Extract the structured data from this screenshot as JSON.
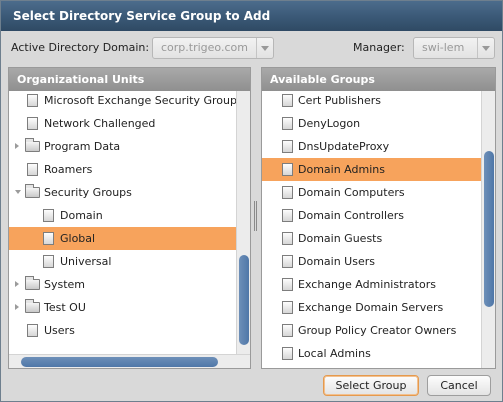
{
  "dialog": {
    "title": "Select Directory Service Group to Add"
  },
  "filters": {
    "domain_label": "Active Directory Domain:",
    "domain_value": "corp.trigeo.com",
    "manager_label": "Manager:",
    "manager_value": "swi-lem"
  },
  "left_panel": {
    "header": "Organizational Units",
    "items": [
      {
        "label": "Microsoft Exchange Security Groups",
        "icon": "document-icon"
      },
      {
        "label": "Network Challenged",
        "icon": "document-icon"
      },
      {
        "label": "Program Data",
        "icon": "folder-icon",
        "expander": "collapsed"
      },
      {
        "label": "Roamers",
        "icon": "document-icon"
      },
      {
        "label": "Security Groups",
        "icon": "folder-open-icon",
        "expander": "expanded"
      },
      {
        "label": "Domain",
        "icon": "document-icon"
      },
      {
        "label": "Global",
        "icon": "document-icon",
        "selected": true
      },
      {
        "label": "Universal",
        "icon": "document-icon"
      },
      {
        "label": "System",
        "icon": "folder-icon",
        "expander": "collapsed"
      },
      {
        "label": "Test OU",
        "icon": "folder-icon",
        "expander": "collapsed"
      },
      {
        "label": "Users",
        "icon": "document-icon"
      }
    ]
  },
  "right_panel": {
    "header": "Available Groups",
    "items": [
      {
        "label": "Cert Publishers"
      },
      {
        "label": "DenyLogon"
      },
      {
        "label": "DnsUpdateProxy"
      },
      {
        "label": "Domain Admins",
        "selected": true
      },
      {
        "label": "Domain Computers"
      },
      {
        "label": "Domain Controllers"
      },
      {
        "label": "Domain Guests"
      },
      {
        "label": "Domain Users"
      },
      {
        "label": "Exchange Administrators"
      },
      {
        "label": "Exchange Domain Servers"
      },
      {
        "label": "Group Policy Creator Owners"
      },
      {
        "label": "Local Admins"
      }
    ]
  },
  "buttons": {
    "select_label": "Select Group",
    "cancel_label": "Cancel"
  },
  "colors": {
    "selection": "#f7a35c",
    "title_bar": "#3a5876",
    "scrollbar_thumb": "#5a80ad"
  }
}
